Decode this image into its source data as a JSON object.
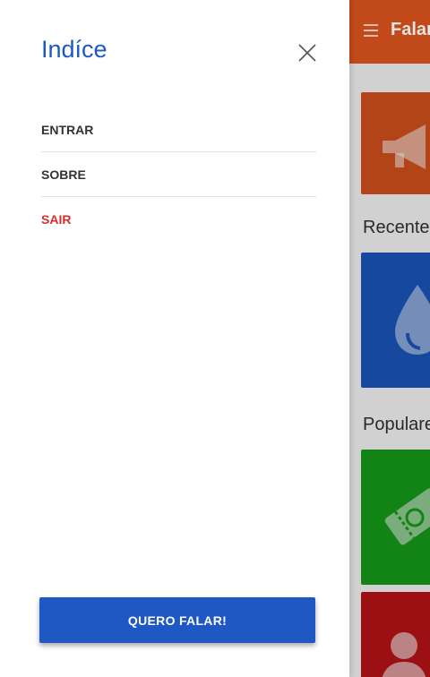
{
  "drawer": {
    "title": "Indíce",
    "close_icon": "close-icon",
    "menu": [
      {
        "label": "ENTRAR",
        "variant": "default"
      },
      {
        "label": "SOBRE",
        "variant": "default"
      },
      {
        "label": "SAIR",
        "variant": "danger"
      }
    ],
    "cta_label": "QUERO FALAR!"
  },
  "app": {
    "title": "Falar",
    "sections": [
      "Recentes",
      "Populares"
    ],
    "colors": {
      "appbar": "#d9531e",
      "blue": "#1d58c4",
      "green": "#16a01a",
      "red": "#bf1318",
      "danger_text": "#d32f2f"
    },
    "cards": [
      {
        "icon": "megaphone-icon"
      },
      {
        "icon": "water-drop-icon"
      },
      {
        "icon": "ticket-icon"
      },
      {
        "icon": "person-icon"
      }
    ]
  }
}
